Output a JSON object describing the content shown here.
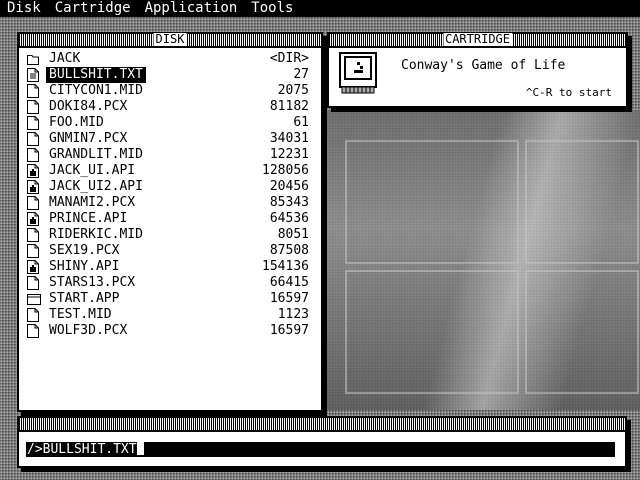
{
  "menubar": {
    "items": [
      {
        "label": "Disk"
      },
      {
        "label": "Cartridge"
      },
      {
        "label": "Application"
      },
      {
        "label": "Tools"
      }
    ]
  },
  "disk": {
    "title": "DISK",
    "files": [
      {
        "name": "JACK",
        "size": "<DIR>",
        "icon": "folder-icon"
      },
      {
        "name": "BULLSHIT.TXT",
        "size": "27",
        "icon": "text-file-icon",
        "selected": true
      },
      {
        "name": "CITYCON1.MID",
        "size": "2075",
        "icon": "file-icon"
      },
      {
        "name": "DOKI84.PCX",
        "size": "81182",
        "icon": "file-icon"
      },
      {
        "name": "FOO.MID",
        "size": "61",
        "icon": "file-icon"
      },
      {
        "name": "GNMIN7.PCX",
        "size": "34031",
        "icon": "file-icon"
      },
      {
        "name": "GRANDLIT.MID",
        "size": "12231",
        "icon": "file-icon"
      },
      {
        "name": "JACK_UI.API",
        "size": "128056",
        "icon": "api-file-icon"
      },
      {
        "name": "JACK_UI2.API",
        "size": "20456",
        "icon": "api-file-icon"
      },
      {
        "name": "MANAMI2.PCX",
        "size": "85343",
        "icon": "file-icon"
      },
      {
        "name": "PRINCE.API",
        "size": "64536",
        "icon": "api-file-icon"
      },
      {
        "name": "RIDERKIC.MID",
        "size": "8051",
        "icon": "file-icon"
      },
      {
        "name": "SEX19.PCX",
        "size": "87508",
        "icon": "file-icon"
      },
      {
        "name": "SHINY.API",
        "size": "154136",
        "icon": "api-file-icon"
      },
      {
        "name": "STARS13.PCX",
        "size": "66415",
        "icon": "file-icon"
      },
      {
        "name": "START.APP",
        "size": "16597",
        "icon": "app-icon"
      },
      {
        "name": "TEST.MID",
        "size": "1123",
        "icon": "file-icon"
      },
      {
        "name": "WOLF3D.PCX",
        "size": "16597",
        "icon": "file-icon"
      }
    ]
  },
  "cartridge": {
    "title": "CARTRIDGE",
    "name": "Conway's Game of Life",
    "hint": "^C-R to start",
    "icon": "cartridge-icon"
  },
  "cli": {
    "value": "/>BULLSHIT.TXT"
  }
}
